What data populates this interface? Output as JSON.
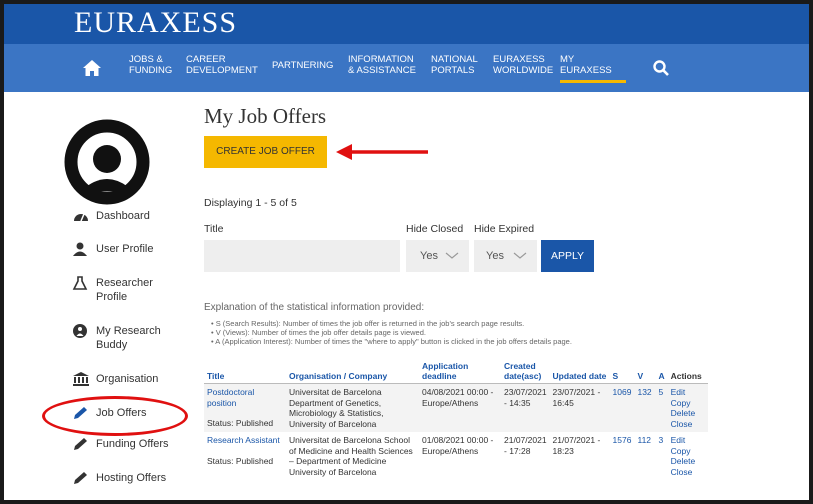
{
  "brand": "EURAXESS",
  "nav": {
    "items": [
      {
        "line1": "Jobs &",
        "line2": "Funding"
      },
      {
        "line1": "Career",
        "line2": "Development"
      },
      {
        "line1": "Partnering",
        "line2": ""
      },
      {
        "line1": "Information",
        "line2": "& Assistance"
      },
      {
        "line1": "National",
        "line2": "Portals"
      },
      {
        "line1": "Euraxess",
        "line2": "Worldwide"
      },
      {
        "line1": "My",
        "line2": "Euraxess"
      }
    ]
  },
  "sidebar": {
    "items": [
      {
        "label": "Dashboard",
        "icon": "dashboard-icon"
      },
      {
        "label": "User Profile",
        "icon": "user-icon"
      },
      {
        "label": "Researcher Profile",
        "icon": "flask-icon"
      },
      {
        "label": "My Research Buddy",
        "icon": "buddy-icon"
      },
      {
        "label": "Organisation",
        "icon": "institution-icon"
      },
      {
        "label": "Job Offers",
        "icon": "pencil-icon"
      },
      {
        "label": "Funding Offers",
        "icon": "pencil-icon"
      },
      {
        "label": "Hosting Offers",
        "icon": "pencil-icon"
      }
    ]
  },
  "main": {
    "title": "My Job Offers",
    "create_label": "Create job offer",
    "displaying": "Displaying 1 - 5 of 5",
    "filters": {
      "title_label": "Title",
      "hide_closed_label": "Hide Closed",
      "hide_expired_label": "Hide Expired",
      "hide_closed_value": "Yes",
      "hide_expired_value": "Yes",
      "apply_label": "Apply"
    },
    "explain_title": "Explanation of the statistical information provided:",
    "explain_items": [
      "S (Search Results): Number of times the job offer is returned in the job's search page results.",
      "V (Views): Number of times the job offer details page is viewed.",
      "A (Application Interest): Number of times the \"where to apply\" button is clicked in the job offers details page."
    ]
  },
  "table": {
    "headers": {
      "title": "Title",
      "org": "Organisation / Company",
      "deadline": "Application deadline",
      "created": "Created date(asc)",
      "updated": "Updated date",
      "s": "S",
      "v": "V",
      "a": "A",
      "actions": "Actions"
    },
    "rows": [
      {
        "title": "Postdoctoral position",
        "status": "Status: Published",
        "org": "Universitat de Barcelona Department of Genetics, Microbiology & Statistics, University of Barcelona",
        "deadline": "04/08/2021 00:00 - Europe/Athens",
        "created": "23/07/2021 - 14:35",
        "updated": "23/07/2021 - 16:45",
        "s": "1069",
        "v": "132",
        "a": "5",
        "actions": [
          "Edit",
          "Copy",
          "Delete",
          "Close"
        ]
      },
      {
        "title": "Research Assistant",
        "status": "Status: Published",
        "org": "Universitat de Barcelona School of Medicine and Health Sciences – Department of Medicine University of Barcelona",
        "deadline": "01/08/2021 00:00 - Europe/Athens",
        "created": "21/07/2021 - 17:28",
        "updated": "21/07/2021 - 18:23",
        "s": "1576",
        "v": "112",
        "a": "3",
        "actions": [
          "Edit",
          "Copy",
          "Delete",
          "Close"
        ]
      }
    ]
  },
  "colors": {
    "header": "#1a56a8",
    "nav": "#3b75c4",
    "accent": "#f5b800",
    "annotation": "#e01010"
  }
}
